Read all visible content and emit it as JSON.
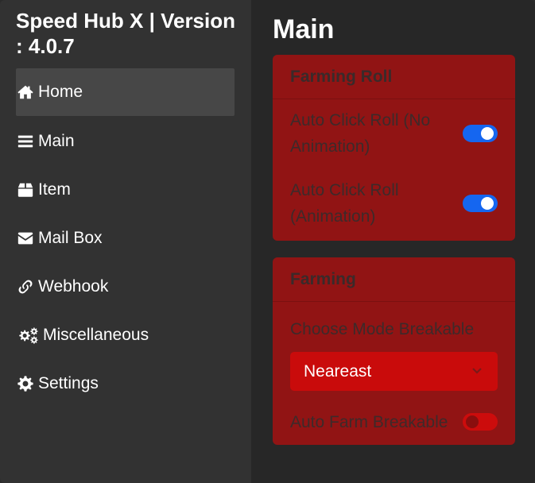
{
  "sidebar": {
    "title": "Speed Hub X | Version : 4.0.7",
    "items": [
      {
        "label": "Home",
        "icon": "home-icon",
        "active": true
      },
      {
        "label": "Main",
        "icon": "bars-icon",
        "active": false
      },
      {
        "label": "Item",
        "icon": "box-icon",
        "active": false
      },
      {
        "label": "Mail Box",
        "icon": "envelope-icon",
        "active": false
      },
      {
        "label": "Webhook",
        "icon": "link-icon",
        "active": false
      },
      {
        "label": "Miscellaneous",
        "icon": "cogs-icon",
        "active": false
      },
      {
        "label": "Settings",
        "icon": "gear-icon",
        "active": false
      }
    ]
  },
  "main": {
    "title": "Main",
    "farming_roll": {
      "header": "Farming Roll",
      "toggles": [
        {
          "label": "Auto Click Roll (No Animation)",
          "state": "on"
        },
        {
          "label": "Auto Click Roll (Animation)",
          "state": "on"
        }
      ]
    },
    "farming": {
      "header": "Farming",
      "mode_label": "Choose Mode Breakable",
      "mode_value": "Neareast",
      "auto_farm_label": "Auto Farm Breakable",
      "auto_farm_state": "off"
    }
  },
  "colors": {
    "accent_blue": "#1566f0",
    "card_red": "#911414",
    "dropdown_red": "#c90b0b",
    "sidebar_bg": "#323232",
    "main_bg": "#272727"
  }
}
